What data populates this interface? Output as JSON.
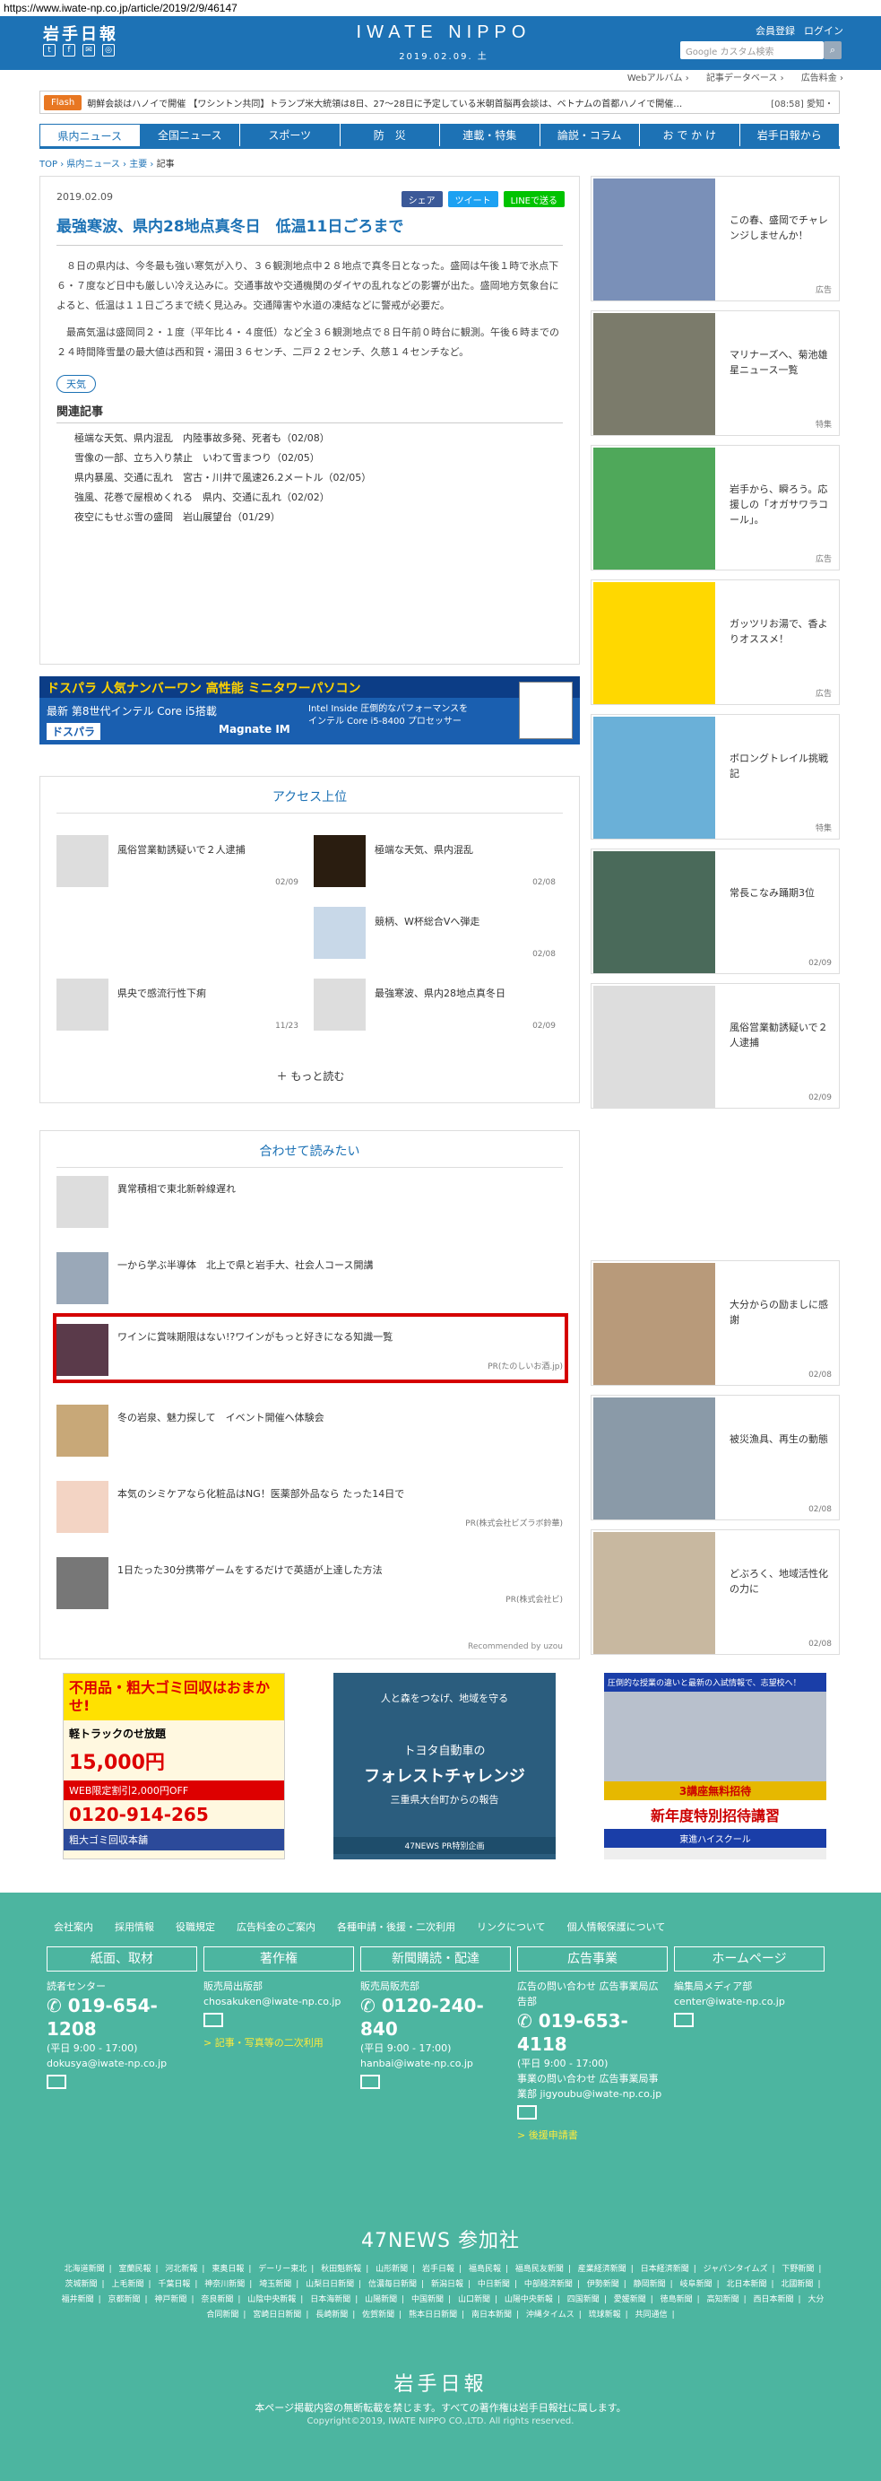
{
  "url": "https://www.iwate-np.co.jp/article/2019/2/9/46147",
  "header": {
    "logo": "岩手日報",
    "brand": "IWATE NIPPO",
    "date": "2019.02.09. 土",
    "member_login": "会員登録",
    "login": "ログイン",
    "search_placeholder": "Google カスタム検索",
    "sublinks": [
      "Webアルバム ›",
      "記事データベース ›",
      "広告料金 ›"
    ]
  },
  "flash": {
    "label": "Flash",
    "text": "朝鮮会談はハノイで開催 【ワシントン共同】トランプ米大統領は8日、27～28日に予定している米朝首脳再会談は、ベトナムの首都ハノイで開催…",
    "time": "[08:58]",
    "extra": "愛知・"
  },
  "nav": [
    "県内ニュース",
    "全国ニュース",
    "スポーツ",
    "防　災",
    "連載・特集",
    "論説・コラム",
    "お で か け",
    "岩手日報から"
  ],
  "crumb": [
    "TOP",
    "県内ニュース",
    "主要",
    "記事"
  ],
  "article": {
    "date": "2019.02.09",
    "share": [
      "シェア",
      "ツイート",
      "LINEで送る"
    ],
    "title": "最強寒波、県内28地点真冬日　低温11日ごろまで",
    "paragraphs": [
      "８日の県内は、今冬最も強い寒気が入り、３６観測地点中２８地点で真冬日となった。盛岡は午後１時で氷点下６・７度など日中も厳しい冷え込みに。交通事故や交通機関のダイヤの乱れなどの影響が出た。盛岡地方気象台によると、低温は１１日ごろまで続く見込み。交通障害や水道の凍結などに警戒が必要だ。",
      "最高気温は盛岡同２・１度（平年比４・４度低）など全３６観測地点で８日午前０時台に観測。午後６時までの２４時間降雪量の最大値は西和賀・湯田３６センチ、二戸２２センチ、久慈１４センチなど。"
    ],
    "tag": "天気",
    "related_heading": "関連記事",
    "related": [
      "極端な天気、県内混乱　内陸事故多発、死者も（02/08）",
      "雪像の一部、立ち入り禁止　いわて雪まつり（02/05）",
      "県内暴風、交通に乱れ　宮古・川井で風速26.2メートル（02/05）",
      "強風、花巻で屋根めくれる　県内、交通に乱れ（02/02）",
      "夜空にもせぶ雪の盛岡　岩山展望台（01/29）"
    ]
  },
  "banner": {
    "title": "ドスパラ 人気ナンバーワン 高性能 ミニタワーパソコン",
    "sub": "最新 第8世代インテル Core i5搭載",
    "brand": "ドスパラ",
    "model": "Magnate IM",
    "cpu": "Intel Inside 圧倒的なパフォーマンスを インテル Core i5-8400 プロセッサー"
  },
  "access": {
    "heading": "アクセス上位",
    "items": [
      {
        "text": "風俗営業勧誘疑いで２人逮捕",
        "date": "02/09"
      },
      {
        "text": "極端な天気、県内混乱",
        "date": "02/08"
      },
      {
        "text": "競柄、W杯総合Vへ弾走",
        "date": "02/08"
      },
      {
        "text": "県央で感流行性下痢",
        "date": "11/23"
      },
      {
        "text": "最強寒波、県内28地点真冬日",
        "date": "02/09"
      }
    ],
    "more": "もっと読む"
  },
  "recommend": {
    "heading": "合わせて読みたい",
    "items": [
      {
        "text": "異常積相で東北新幹線遅れ",
        "pr": ""
      },
      {
        "text": "一から学ぶ半導体　北上で県と岩手大、社会人コース開講",
        "pr": ""
      },
      {
        "text": "ワインに賞味期限はない!?ワインがもっと好きになる知識一覧",
        "pr": "PR(たのしいお酒.jp)"
      },
      {
        "text": "冬の岩泉、魅力探して　イベント開催へ体験会",
        "pr": ""
      },
      {
        "text": "本気のシミケアなら化粧品はNG！医薬部外品なら たった14日で",
        "pr": "PR(株式会社ビズラボ鈴華)"
      },
      {
        "text": "1日たった30分携帯ゲームをするだけで英語が上達した方法",
        "pr": "PR(株式会社ビ)"
      }
    ],
    "foot": "Recommended by uzou"
  },
  "ads": {
    "ad1": [
      "不用品・粗大ゴミ回収はおまかせ!",
      "軽トラックのせ放題",
      "15,000円",
      "WEB限定割引2,000円OFF",
      "0120-914-265",
      "粗大ゴミ回収本舗"
    ],
    "ad2": [
      "人と森をつなげ、地域を守る",
      "トヨタ自動車の",
      "フォレストチャレンジ",
      "三重県大台町からの報告",
      "47NEWS PR特別企画"
    ],
    "ad3": [
      "圧倒的な授業の違いと最新の入試情報で、志望校へ！",
      "3講座無料招待",
      "新年度特別招待講習",
      "東進ハイスクール"
    ]
  },
  "sidebar": [
    {
      "text": "この春、盛岡でチャレンジしませんか！",
      "label": "広告"
    },
    {
      "text": "マリナーズへ、菊池雄星ニュース一覧",
      "label": "特集"
    },
    {
      "text": "岩手から、瞬ろう。応援しの「オガサワラコール」。",
      "label": "広告"
    },
    {
      "text": "ガッツリお湯で、香よりオススメ！",
      "label": "広告"
    },
    {
      "text": "ボロングトレイル挑戦記",
      "label": "特集"
    },
    {
      "text": "常長こなみ踊期3位",
      "label": "02/09"
    },
    {
      "text": "風俗営業勧誘疑いで２人逮捕",
      "label": "02/09"
    },
    {
      "text": "大分からの励ましに感謝",
      "label": "02/08"
    },
    {
      "text": "被災漁具、再生の動態",
      "label": "02/08"
    },
    {
      "text": "どぶろく、地域活性化の力に",
      "label": "02/08"
    }
  ],
  "footer": {
    "links": [
      "会社案内",
      "採用情報",
      "役職規定",
      "広告料金のご案内",
      "各種申請・後援・二次利用",
      "リンクについて",
      "個人情報保護について"
    ],
    "cols": [
      {
        "head": "紙面、取材",
        "l1": "読者センター",
        "tel": "019-654-1208",
        "hours": "(平日 9:00 - 17:00)",
        "mail": "dokusya@iwate-np.co.jp",
        "link": ""
      },
      {
        "head": "著作権",
        "l1": "販売局出版部",
        "tel": "",
        "hours": "",
        "mail": "chosakuken@iwate-np.co.jp",
        "link": "> 記事・写真等の二次利用"
      },
      {
        "head": "新聞購読・配達",
        "l1": "販売局販売部",
        "tel": "0120-240-840",
        "hours": "(平日 9:00 - 17:00)",
        "mail": "hanbai@iwate-np.co.jp",
        "link": ""
      },
      {
        "head": "広告事業",
        "l1": "広告の問い合わせ 広告事業局広告部",
        "tel": "019-653-4118",
        "hours": "(平日 9:00 - 17:00)",
        "mail": "事業の問い合わせ 広告事業局事業部 jigyoubu@iwate-np.co.jp",
        "link": "> 後援申請書"
      },
      {
        "head": "ホームページ",
        "l1": "編集局メディア部",
        "tel": "",
        "hours": "",
        "mail": "center@iwate-np.co.jp",
        "link": ""
      }
    ],
    "news_heading": "47NEWS 参加社",
    "news_list": [
      "北海道新聞",
      "室蘭民報",
      "河北新報",
      "東奥日報",
      "デーリー東北",
      "秋田魁新報",
      "山形新聞",
      "岩手日報",
      "福島民報",
      "福島民友新聞",
      "産業経済新聞",
      "日本経済新聞",
      "ジャパンタイムズ",
      "下野新聞",
      "茨城新聞",
      "上毛新聞",
      "千葉日報",
      "神奈川新聞",
      "埼玉新聞",
      "山梨日日新聞",
      "信濃毎日新聞",
      "新潟日報",
      "中日新聞",
      "中部経済新聞",
      "伊勢新聞",
      "静岡新聞",
      "岐阜新聞",
      "北日本新聞",
      "北國新聞",
      "福井新聞",
      "京都新聞",
      "神戸新聞",
      "奈良新聞",
      "山陰中央新報",
      "日本海新聞",
      "山陽新聞",
      "中国新聞",
      "山口新聞",
      "山陽中央新報",
      "四国新聞",
      "愛媛新聞",
      "徳島新聞",
      "高知新聞",
      "西日本新聞",
      "大分合同新聞",
      "宮崎日日新聞",
      "長崎新聞",
      "佐賀新聞",
      "熊本日日新聞",
      "南日本新聞",
      "沖縄タイムス",
      "琉球新報",
      "共同通信"
    ],
    "logo": "岩手日報",
    "note": "本ページ掲載内容の無断転載を禁じます。すべての著作権は岩手日報社に属します。",
    "copyright": "Copyright©2019, IWATE NIPPO CO.,LTD. All rights reserved."
  },
  "colors": {
    "primary": "#1d72b5",
    "footer": "#4cb5a0",
    "flash": "#e87722",
    "highlight": "#d50000"
  }
}
